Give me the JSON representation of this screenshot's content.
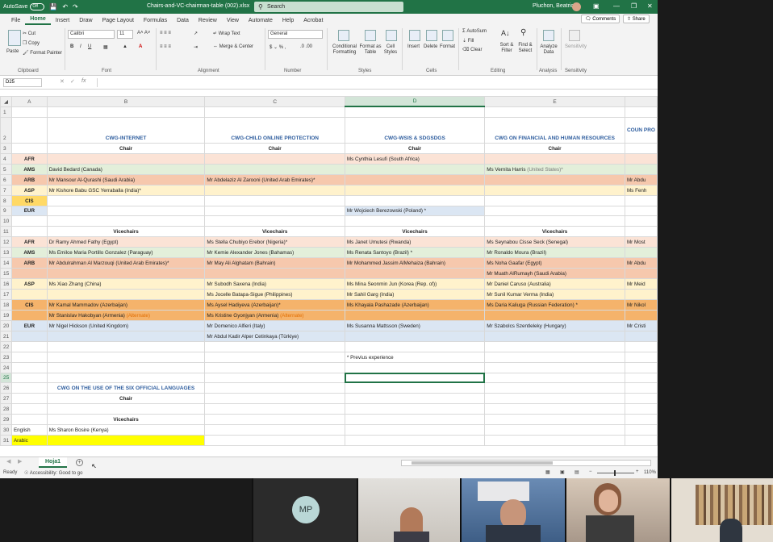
{
  "titlebar": {
    "autosave_label": "AutoSave",
    "autosave_state": "Off",
    "filename": "Chairs-and-VC-chairman-table (002).xlsx",
    "search_placeholder": "Search",
    "user_name": "Pluchon, Beatrice"
  },
  "menu": {
    "tabs": [
      "File",
      "Home",
      "Insert",
      "Draw",
      "Page Layout",
      "Formulas",
      "Data",
      "Review",
      "View",
      "Automate",
      "Help",
      "Acrobat"
    ],
    "active": "Home",
    "comments": "Comments",
    "share": "Share"
  },
  "ribbon": {
    "clipboard": {
      "paste": "Paste",
      "cut": "Cut",
      "copy": "Copy",
      "format_painter": "Format Painter",
      "label": "Clipboard"
    },
    "font": {
      "name": "Calibri",
      "size": "11",
      "label": "Font"
    },
    "alignment": {
      "wrap": "Wrap Text",
      "merge": "Merge & Center",
      "label": "Alignment"
    },
    "number": {
      "format": "General",
      "label": "Number"
    },
    "styles": {
      "conditional": "Conditional Formatting",
      "format_table": "Format as Table",
      "cell_styles": "Cell Styles",
      "label": "Styles"
    },
    "cells": {
      "insert": "Insert",
      "delete": "Delete",
      "format": "Format",
      "label": "Cells"
    },
    "editing": {
      "autosum": "AutoSum",
      "fill": "Fill",
      "clear": "Clear",
      "sort": "Sort & Filter",
      "find": "Find & Select",
      "label": "Editing"
    },
    "analysis": {
      "analyze": "Analyze Data",
      "label": "Analysis"
    },
    "sensitivity": {
      "label": "Sensitivity"
    }
  },
  "formula_bar": {
    "namebox": "D25",
    "fx": "fx",
    "content": ""
  },
  "columns": [
    "A",
    "B",
    "C",
    "D",
    "E"
  ],
  "partial_column": {
    "row2": "COUN",
    "row2b": "PRO"
  },
  "sheet": {
    "row2": {
      "b": "CWG-INTERNET",
      "c": "CWG-CHILD ONLINE PROTECTION",
      "d": "CWG-WSIS & SDGSDGS",
      "e": "CWG ON FINANCIAL AND HUMAN RESOURCES",
      "f": "COUN PRO"
    },
    "chair_label": "Chair",
    "vicechairs_label": "Vicechairs",
    "chairs": [
      {
        "row": "4",
        "region": "AFR",
        "b": "",
        "c": "",
        "d": "Ms Cynthia Lesufi (South Africa)",
        "e": "",
        "f": ""
      },
      {
        "row": "5",
        "region": "AMS",
        "b": "David Bedard (Canada)",
        "c": "",
        "d": "",
        "e": "Ms Vernita Harris",
        "e_note": "(United States)*",
        "f": ""
      },
      {
        "row": "6",
        "region": "ARB",
        "b": "Mr Mansour Al-Qurashi (Saudi Arabia)",
        "c": "Mr Abdelaziz Al Zarooni (United Arab Emirates)*",
        "d": "",
        "e": "",
        "f": "Mr Abdu"
      },
      {
        "row": "7",
        "region": "ASP",
        "b": "Mr Kishore Babu GSC Yerraballa (India)*",
        "c": "",
        "d": "",
        "e": "",
        "f": "Ms Fenh"
      },
      {
        "row": "8",
        "region": "CIS",
        "b": "",
        "c": "",
        "d": "",
        "e": "",
        "f": ""
      },
      {
        "row": "9",
        "region": "EUR",
        "b": "",
        "c": "",
        "d": "Mr Wojciech Berezowski (Poland) *",
        "e": "",
        "f": ""
      }
    ],
    "vicechairs": [
      {
        "row": "12",
        "region": "AFR",
        "b": "Dr Ramy Ahmed Fathy (Egypt)",
        "c": "Ms Stella Chubiyo Erebor (Nigeria)*",
        "d": "Ms Janet Umutesi (Rwanda)",
        "e": "Ms Seynabou Cisse Seck (Senegal)",
        "f": "Mr Most"
      },
      {
        "row": "13",
        "region": "AMS",
        "b": "Ms Emilce Maria Portillo Gonzalez (Paraguay)",
        "c": "Mr Kemie Alexander Jones (Bahamas)",
        "d": "Ms Renata Santoyo (Brazil) *",
        "e": "Mr Ronaldo Moura (Brazil)",
        "f": ""
      },
      {
        "row": "14",
        "region": "ARB",
        "b": "Mr Abdulrahman Al Marzouqi (United Arab Emirates)*",
        "c": "Mr May Ali Alghatam (Bahrain)",
        "d": "Mr Mohammed Jassim AlMehaiza (Bahrain)",
        "e": "Ms Noha Gaafar (Egypt)",
        "f": "Mr Abdu"
      },
      {
        "row": "15",
        "region": "",
        "b": "",
        "c": "",
        "d": "",
        "e": "Mr Muath AlRumayh (Saudi Arabia)",
        "f": ""
      },
      {
        "row": "16",
        "region": "ASP",
        "b": "Ms Xiao Zhang (China)",
        "c": "Mr Subodh Saxena (India)",
        "d": "Ms Mina Seonmin Jun (Korea (Rep. of))",
        "e": "Mr Daniel Caruso (Australia)",
        "f": "Mr Meid"
      },
      {
        "row": "17",
        "region": "",
        "b": "",
        "c": "Ms Jocelle Batapa-Sigue (Philippines)",
        "d": "Mr Sahil Garg (India)",
        "e": "Mr Sunil Kumar Verma (India)",
        "f": ""
      },
      {
        "row": "18",
        "region": "CIS",
        "b": "Mr Kamal Mammadov (Azerbaijan)",
        "c": "Ms Aysel Hadiyeva (Azerbaijan)*",
        "d": "Ms Khayala Pashazade (Azerbaijan)",
        "e": "Ms Daria Kaliuga (Russian Federation) *",
        "f": "Mr Nikol"
      },
      {
        "row": "19",
        "region": "",
        "b": "Mr Stanislav Hakobyan (Armenia)",
        "b_alt": "(Alternate)",
        "c": "Ms Kristine Gyonjyan (Armenia)",
        "c_alt": "(Alternate)",
        "d": "",
        "e": "",
        "f": ""
      },
      {
        "row": "20",
        "region": "EUR",
        "b": "Mr Nigel Hickson (United Kingdom)",
        "c": "Mr Domenico Alfieri (Italy)",
        "d": "Ms Susanna Mattsson (Sweden)",
        "e": "Mr Szabolcs Szentleleky (Hungary)",
        "f": "Mr Cristi"
      },
      {
        "row": "21",
        "region": "",
        "b": "",
        "c": "Mr Abdul Kadir Alper Cetinkaya (Türkiye)",
        "d": "",
        "e": "",
        "f": ""
      }
    ],
    "note_row23": "* Previus experience",
    "row26": "CWG ON THE USE OF THE SIX OFFICIAL LANGUAGES",
    "row30": {
      "a": "English",
      "b": "Ms Sharon Bosire (Kenya)"
    },
    "row31": {
      "a": "Arabic",
      "b": ""
    }
  },
  "sheetbar": {
    "tab": "Hoja1",
    "add": "+"
  },
  "statusbar": {
    "ready": "Ready",
    "accessibility": "Accessibility: Good to go",
    "zoom": "110%"
  },
  "video": {
    "initials": "MP"
  },
  "colors": {
    "excel_green": "#217346",
    "afr": "#fbe3d6",
    "ams": "#e3efda",
    "arb": "#f6c8ad",
    "asp": "#fff2cc",
    "cis": "#ffd966",
    "eur": "#dbe6f3",
    "heading_blue": "#2e5d9e",
    "alternate": "#e06c00"
  }
}
